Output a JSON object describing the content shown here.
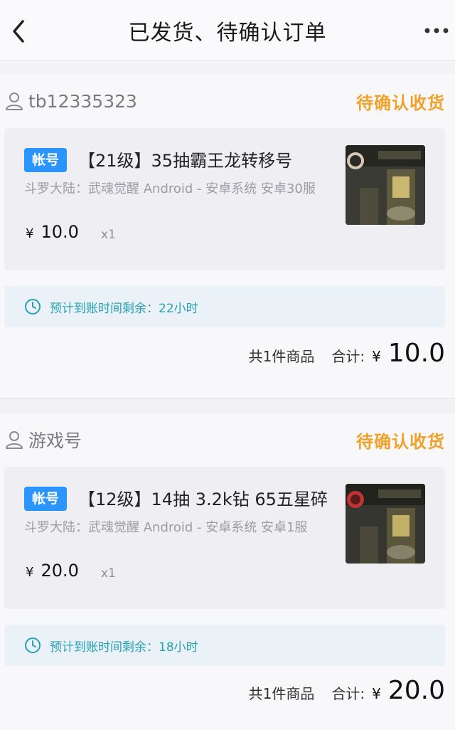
{
  "header": {
    "title": "已发货、待确认订单"
  },
  "orders": [
    {
      "seller": "tb12335323",
      "status": "待确认收货",
      "tag": "帐号",
      "title": "【21级】35抽霸王龙转移号",
      "desc": "斗罗大陆：武魂觉醒    Android - 安卓系统    安卓30服",
      "price": "10.0",
      "yen": "¥",
      "qty": "x1",
      "eta": "预计到账时间剩余：22小时",
      "count": "共1件商品",
      "sum_label": "合计:",
      "sum_value": "10.0"
    },
    {
      "seller": "游戏号",
      "status": "待确认收货",
      "tag": "帐号",
      "title": "【12级】14抽 3.2k钻 65五星碎",
      "desc": "斗罗大陆：武魂觉醒    Android - 安卓系统    安卓1服",
      "price": "20.0",
      "yen": "¥",
      "qty": "x1",
      "eta": "预计到账时间剩余：18小时",
      "count": "共1件商品",
      "sum_label": "合计:",
      "sum_value": "20.0"
    }
  ],
  "icons": {
    "back": "chevron-left-icon",
    "more": "more-dots-icon",
    "user": "user-icon",
    "clock": "clock-icon"
  },
  "colors": {
    "status": "#f0a22a",
    "tag": "#2a95ff",
    "eta": "#27a0b5"
  }
}
